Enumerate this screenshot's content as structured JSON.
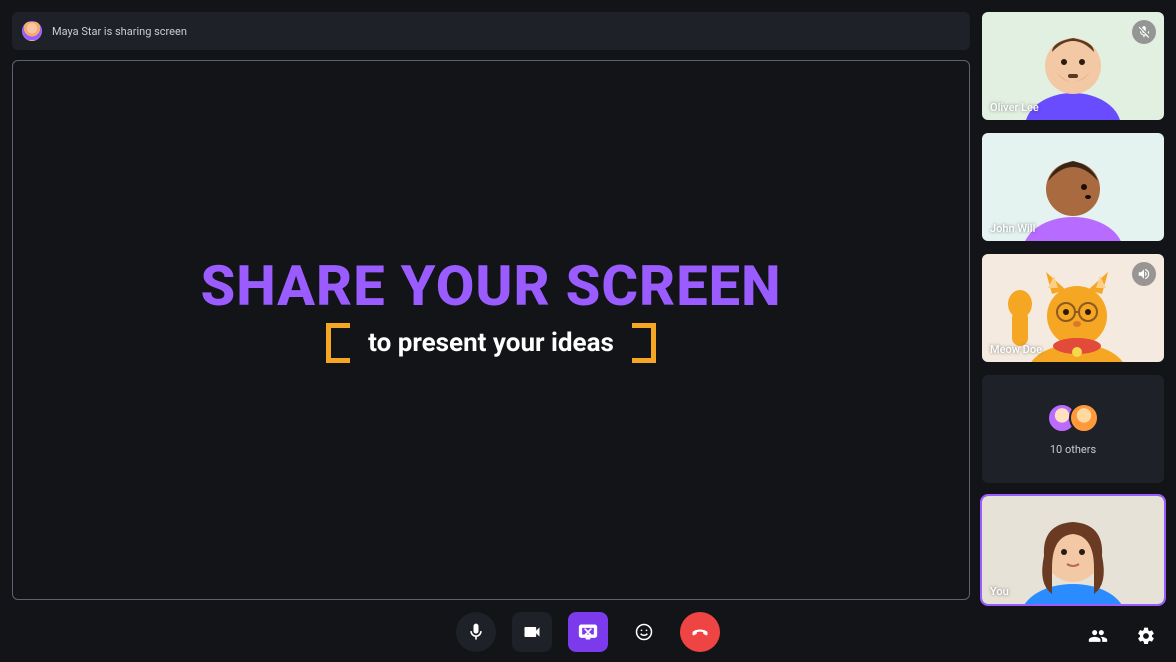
{
  "notice": {
    "text": "Maya Star is sharing screen"
  },
  "shared_content": {
    "title": "SHARE YOUR SCREEN",
    "subtitle": "to present your ideas"
  },
  "participants": [
    {
      "name": "Oliver Lee",
      "status_icon": "mic-off",
      "bg": "oliver"
    },
    {
      "name": "John Will",
      "status_icon": null,
      "bg": "john"
    },
    {
      "name": "Meow Doe",
      "status_icon": "speaking",
      "bg": "meow"
    }
  ],
  "others": {
    "count_label": "10 others"
  },
  "self": {
    "name": "You",
    "selected": true
  },
  "controls": {
    "mic": "microphone",
    "camera": "camera",
    "share": "stop-share",
    "emoji": "reactions",
    "hangup": "end-call",
    "people": "participants",
    "settings": "settings"
  }
}
